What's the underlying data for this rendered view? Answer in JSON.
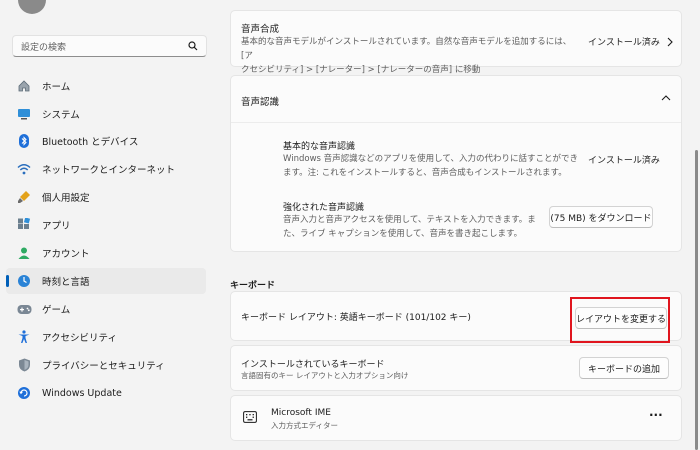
{
  "search": {
    "placeholder": "設定の検索"
  },
  "sidebar": {
    "items": [
      {
        "label": "ホーム",
        "icon": "home-icon"
      },
      {
        "label": "システム",
        "icon": "system-icon"
      },
      {
        "label": "Bluetooth とデバイス",
        "icon": "bluetooth-icon"
      },
      {
        "label": "ネットワークとインターネット",
        "icon": "wifi-icon"
      },
      {
        "label": "個人用設定",
        "icon": "brush-icon"
      },
      {
        "label": "アプリ",
        "icon": "apps-icon"
      },
      {
        "label": "アカウント",
        "icon": "account-icon"
      },
      {
        "label": "時刻と言語",
        "icon": "time-language-icon",
        "active": true
      },
      {
        "label": "ゲーム",
        "icon": "gamepad-icon"
      },
      {
        "label": "アクセシビリティ",
        "icon": "accessibility-icon"
      },
      {
        "label": "プライバシーとセキュリティ",
        "icon": "shield-icon"
      },
      {
        "label": "Windows Update",
        "icon": "update-icon"
      }
    ]
  },
  "speech_synthesis": {
    "title": "音声合成",
    "desc_line1": "基本的な音声モデルがインストールされています。自然な音声モデルを追加するには、[ア",
    "desc_line2": "クセシビリティ] > [ナレーター] > [ナレーターの音声] に移動",
    "status": "インストール済み"
  },
  "speech_recognition": {
    "title": "音声認識",
    "basic": {
      "title": "基本的な音声認識",
      "desc_line1": "Windows 音声認識などのアプリを使用して、入力の代わりに話すことができ",
      "desc_line2": "ます。注: これをインストールすると、音声合成もインストールされます。",
      "status": "インストール済み"
    },
    "enhanced": {
      "title": "強化された音声認識",
      "desc_line1": "音声入力と音声アクセスを使用して、テキストを入力できます。ま",
      "desc_line2": "た、ライブ キャプションを使用して、音声を書き起こします。",
      "button": "(75 MB) をダウンロード"
    }
  },
  "keyboard": {
    "heading": "キーボード",
    "layout_label": "キーボード レイアウト: 英語キーボード (101/102 キー)",
    "change_layout_button": "レイアウトを変更する",
    "installed_title": "インストールされているキーボード",
    "installed_desc": "言語固有のキー レイアウトと入力オプション向け",
    "add_keyboard_button": "キーボードの追加",
    "ime": {
      "title": "Microsoft IME",
      "subtitle": "入力方式エディター",
      "more": "···"
    }
  },
  "colors": {
    "accent": "#005fb8",
    "highlight": "#e0151e"
  }
}
